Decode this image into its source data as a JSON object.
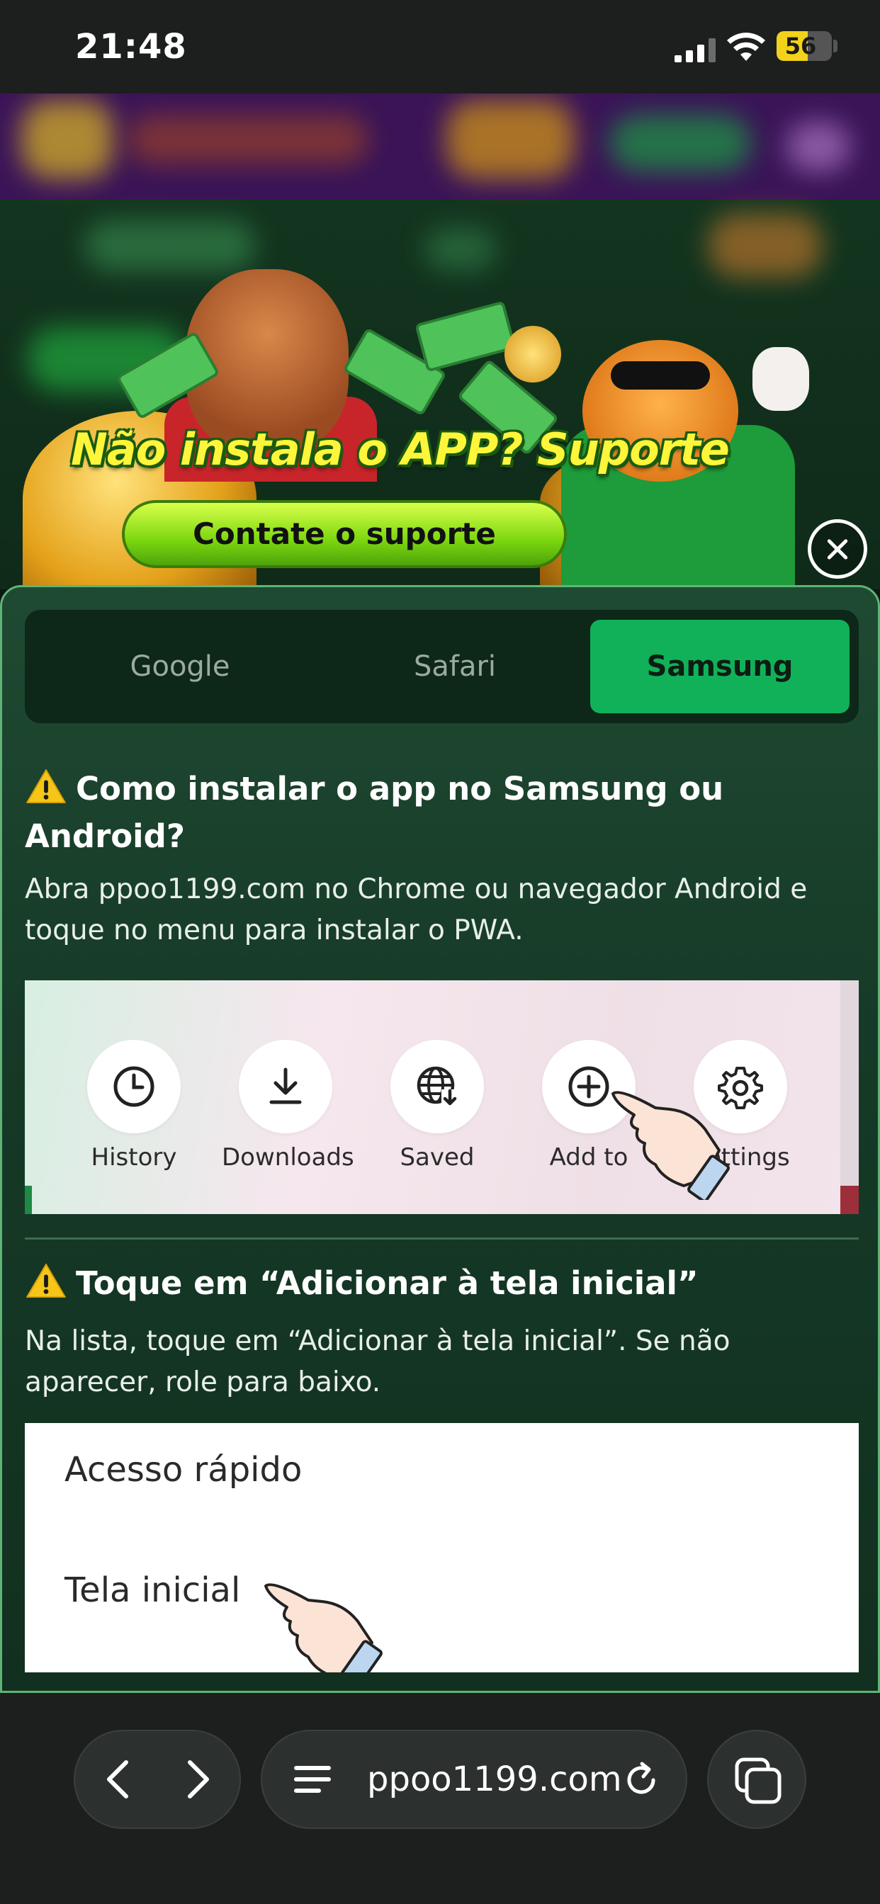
{
  "status_bar": {
    "time": "21:48",
    "battery": "56"
  },
  "banner": {
    "headline": "Não instala o APP? Suporte",
    "cta_label": "Contate o suporte"
  },
  "tabs": [
    {
      "label": "Google",
      "selected": false
    },
    {
      "label": "Safari",
      "selected": false
    },
    {
      "label": "Samsung",
      "selected": true
    }
  ],
  "section1": {
    "title_line1": "Como instalar o app no Samsung ou",
    "title_line2": "Android?",
    "desc_line1": "Abra ppoo1199.com no Chrome ou navegador Android e",
    "desc_line2": "toque no menu para instalar o PWA.",
    "menu_items": [
      {
        "label": "History",
        "icon": "clock-icon"
      },
      {
        "label": "Downloads",
        "icon": "download-icon"
      },
      {
        "label": "Saved",
        "icon": "globe-download-icon"
      },
      {
        "label": "Add to",
        "icon": "plus-circle-icon"
      },
      {
        "label": "Settings",
        "icon": "gear-icon"
      }
    ]
  },
  "section2": {
    "title": "Toque em “Adicionar à tela inicial”",
    "desc_line1": "Na lista, toque em “Adicionar à tela inicial”. Se não",
    "desc_line2": "aparecer, role para baixo.",
    "rows": [
      "Acesso rápido",
      "Tela inicial"
    ]
  },
  "browser": {
    "url": "ppoo1199.com"
  },
  "colors": {
    "accent": "#11b159",
    "panel": "#1f4a32",
    "warning": "#f5c518"
  }
}
